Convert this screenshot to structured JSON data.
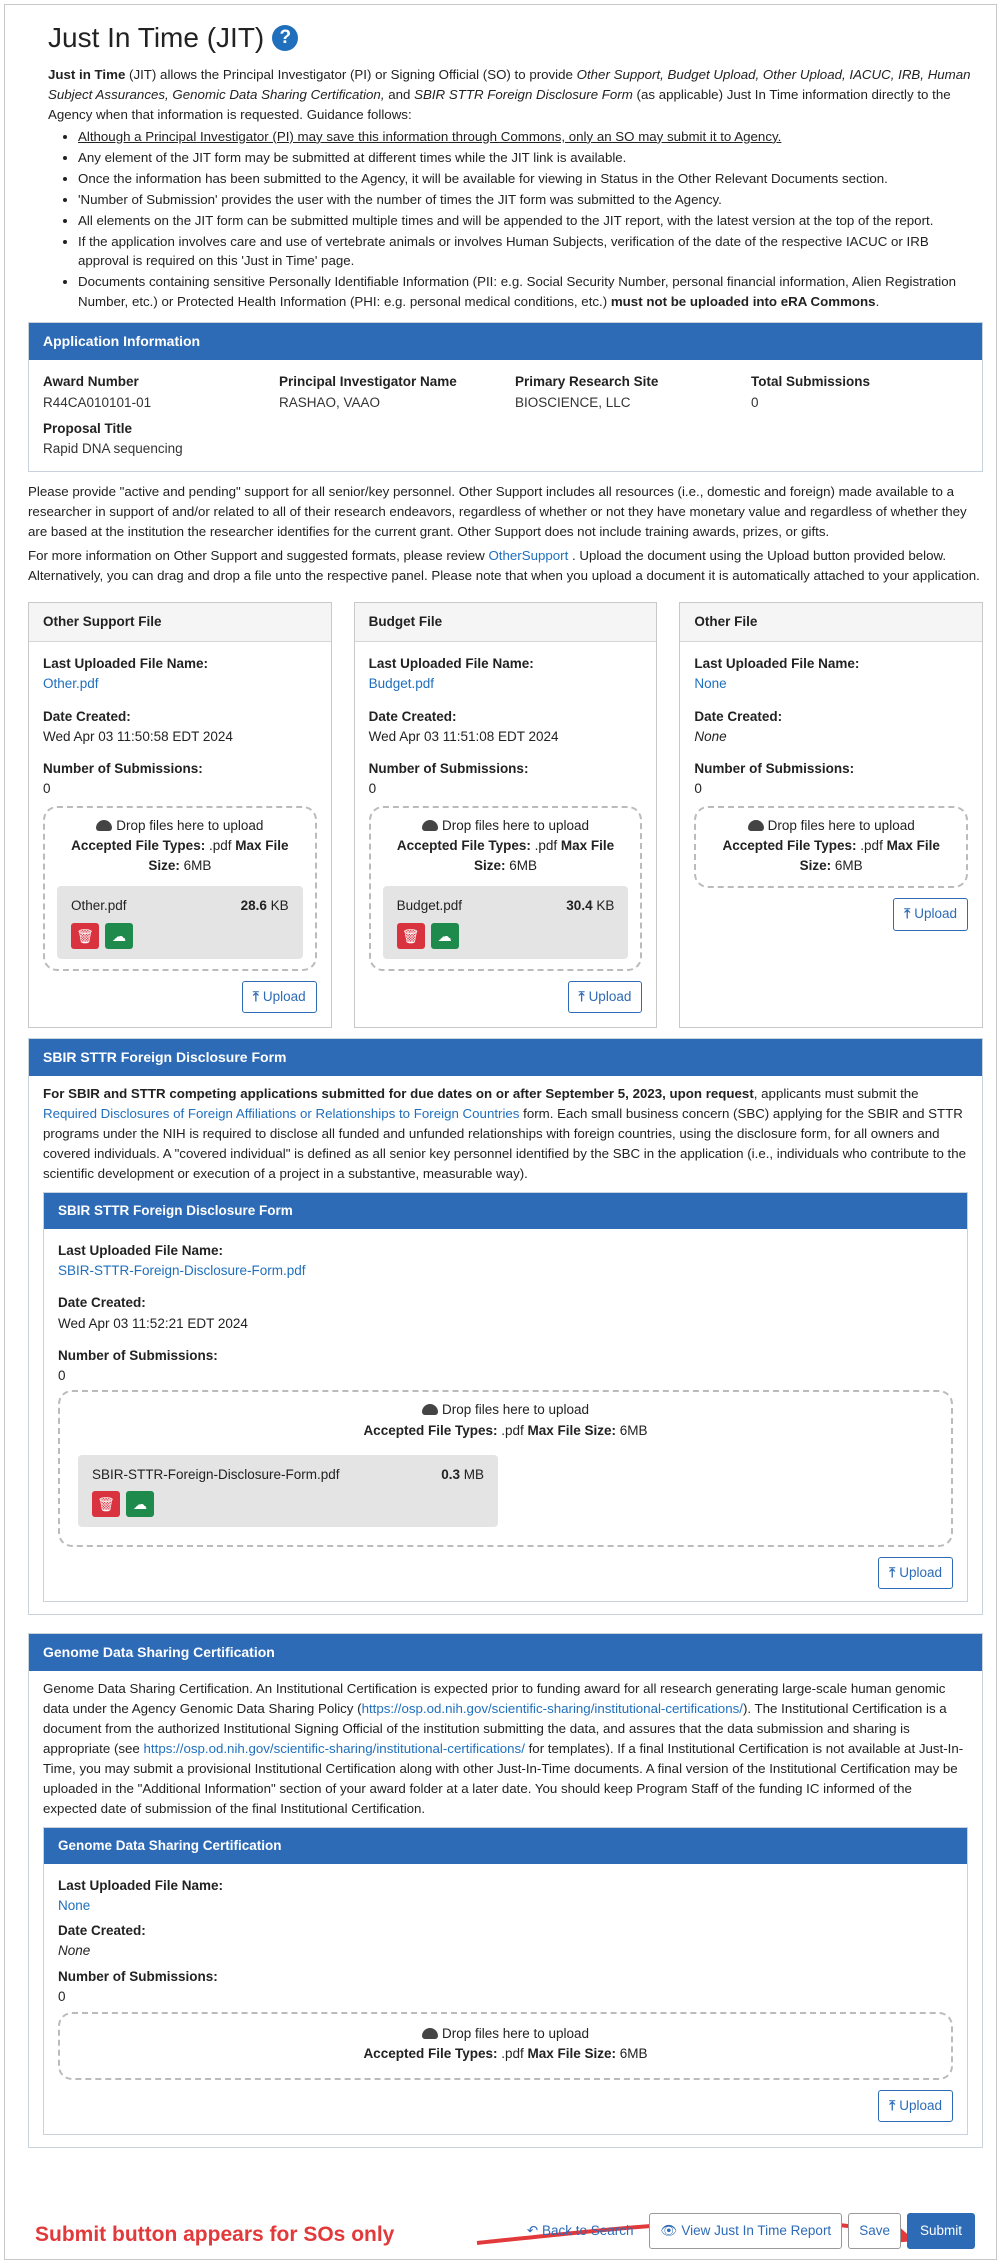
{
  "page": {
    "title": "Just In Time (JIT)",
    "help_glyph": "?"
  },
  "intro": {
    "lead_bold": "Just in Time",
    "lead_rest": " (JIT) allows the Principal Investigator (PI) or Signing Official (SO) to provide ",
    "lead_italic": "Other Support, Budget Upload, Other Upload, IACUC, IRB, Human Subject Assurances, Genomic Data Sharing Certification,",
    "lead_and": " and ",
    "lead_italic2": "SBIR STTR Foreign Disclosure Form",
    "lead_tail": " (as applicable) Just In Time information directly to the Agency when that information is requested.  Guidance follows:",
    "bullets": [
      "Although a Principal Investigator (PI) may save this information through Commons, only an SO may submit it to Agency.",
      "Any element of the JIT form may be submitted at different times while the JIT link is available.",
      "Once the information has been submitted to the Agency, it will be available for viewing in Status in the Other Relevant Documents section.",
      "'Number of Submission' provides the user with the number of times the JIT form was submitted to the Agency.",
      "All elements on the JIT form can be submitted multiple times and will be appended to the JIT report, with the latest version at the top of the report.",
      "If the application involves care and use of vertebrate animals or involves Human Subjects, verification of the date of the respective IACUC or IRB approval is required on this 'Just in Time' page."
    ],
    "last_bullet_text": "Documents containing sensitive Personally Identifiable Information (PII: e.g. Social Security Number, personal financial information, Alien Registration Number, etc.) or Protected Health Information (PHI: e.g. personal medical conditions, etc.) ",
    "last_bullet_bold": "must not be uploaded into eRA Commons",
    "last_bullet_end": "."
  },
  "app_info": {
    "header": "Application Information",
    "award_number_label": "Award Number",
    "award_number": "R44CA010101-01",
    "pi_label": "Principal Investigator Name",
    "pi": "RASHAO, VAAO",
    "site_label": "Primary Research Site",
    "site": "BIOSCIENCE, LLC",
    "total_label": "Total Submissions",
    "total": "0",
    "proposal_label": "Proposal Title",
    "proposal": "Rapid DNA sequencing"
  },
  "support_text": {
    "p1": "Please provide \"active and pending\" support for all senior/key personnel. Other Support includes all resources (i.e., domestic and foreign) made available to a researcher in support of and/or related to all of their research endeavors, regardless of whether or not they have monetary value and regardless of whether they are based at the institution the researcher identifies for the current grant. Other Support does not include training awards, prizes, or gifts.",
    "p2_pre": "For more information on Other Support and suggested formats, please review ",
    "p2_link": "OtherSupport",
    "p2_post": " . Upload the document using the Upload button provided below. Alternatively, you can drag and drop a file unto the respective panel. Please note that when you upload a document it is automatically attached to your application."
  },
  "labels": {
    "last_uploaded": "Last Uploaded File Name:",
    "date_created": "Date Created:",
    "num_submissions": "Number of Submissions:",
    "drop_here": "Drop files here to upload",
    "accepted": "Accepted File Types:",
    "pdf": " .pdf ",
    "max_size": "Max File Size:",
    "size_6mb": " 6MB",
    "upload": "Upload"
  },
  "cards": [
    {
      "title": "Other Support File",
      "file": "Other.pdf",
      "date": "Wed Apr 03 11:50:58 EDT 2024",
      "subs": "0",
      "attached": "Other.pdf",
      "size_num": "28.6",
      "size_unit": " KB"
    },
    {
      "title": "Budget File",
      "file": "Budget.pdf",
      "date": "Wed Apr 03 11:51:08 EDT 2024",
      "subs": "0",
      "attached": "Budget.pdf",
      "size_num": "30.4",
      "size_unit": " KB"
    },
    {
      "title": "Other File",
      "file": "None",
      "date": "None",
      "subs": "0"
    }
  ],
  "sbir": {
    "header": "SBIR STTR Foreign Disclosure Form",
    "intro_bold": "For SBIR and STTR competing applications submitted for due dates on or after September 5, 2023, upon request",
    "intro_mid": ", applicants must submit the ",
    "intro_link": "Required Disclosures of Foreign Affiliations or Relationships to Foreign Countries",
    "intro_rest": " form. Each small business concern (SBC) applying for the SBIR and STTR programs under the NIH is required to disclose all funded and unfunded relationships with foreign countries, using the disclosure form, for all owners and covered individuals. A \"covered individual\" is defined as all senior key personnel identified by the SBC in the application (i.e., individuals who contribute to the scientific development or execution of a project in a substantive, measurable way).",
    "sub_header": "SBIR STTR Foreign Disclosure Form",
    "file": "SBIR-STTR-Foreign-Disclosure-Form.pdf",
    "date": "Wed Apr 03 11:52:21 EDT 2024",
    "subs": "0",
    "attached": "SBIR-STTR-Foreign-Disclosure-Form.pdf",
    "size_num": "0.3",
    "size_unit": " MB"
  },
  "gds": {
    "header": "Genome Data Sharing Certification",
    "p_a": "Genome Data Sharing Certification. An Institutional Certification is expected prior to funding award for all research generating large-scale human genomic data under the Agency Genomic Data Sharing Policy (",
    "link1": "https://osp.od.nih.gov/scientific-sharing/institutional-certifications/",
    "p_b": "). The Institutional Certification is a document from the authorized Institutional Signing Official of the institution submitting the data, and assures that the data submission and sharing is appropriate (see ",
    "link2": "https://osp.od.nih.gov/scientific-sharing/institutional-certifications/",
    "p_c": " for templates). If a final Institutional Certification is not available at Just-In-Time, you may submit a provisional Institutional Certification along with other Just-In-Time documents. A final version of the Institutional Certification may be uploaded in the \"Additional Information\" section of your award folder at a later date. You should keep Program Staff of the funding IC informed of the expected date of submission of the final Institutional Certification.",
    "sub_header": "Genome Data Sharing Certification",
    "file": "None",
    "date": "None",
    "subs": "0"
  },
  "footer": {
    "annotation": "Submit button appears for SOs only",
    "back": "Back to Search",
    "view": "View Just In Time Report",
    "save": "Save",
    "submit": "Submit"
  }
}
